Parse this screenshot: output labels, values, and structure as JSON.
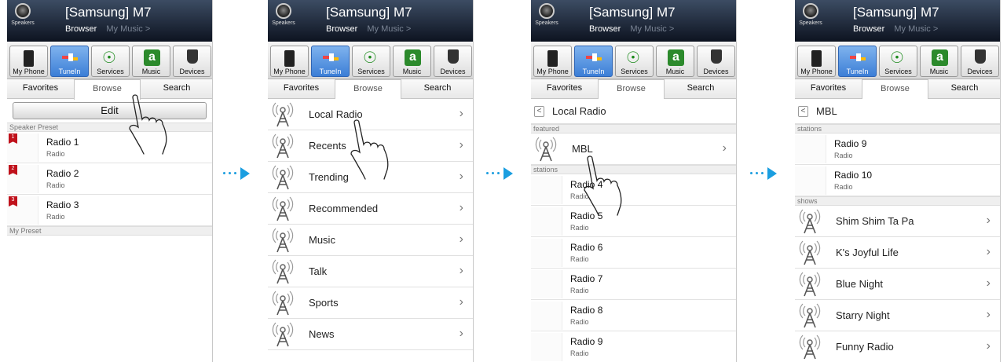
{
  "header": {
    "title": "[Samsung] M7",
    "speakers_label": "Speakers",
    "current_view": "Browser",
    "other_view": "My Music >"
  },
  "sources": [
    {
      "label": "My Phone",
      "icon": "phone-icon"
    },
    {
      "label": "TuneIn",
      "icon": "tunein-icon"
    },
    {
      "label": "Services",
      "icon": "globe-icon"
    },
    {
      "label": "Music",
      "icon": "amazon-icon"
    },
    {
      "label": "Devices",
      "icon": "devices-icon"
    }
  ],
  "tabs": [
    "Favorites",
    "Browse",
    "Search"
  ],
  "screen1": {
    "edit": "Edit",
    "speaker_preset": "Speaker Preset",
    "my_preset": "My Preset",
    "presets": [
      {
        "num": "1",
        "name": "Radio 1",
        "sub": "Radio"
      },
      {
        "num": "2",
        "name": "Radio 2",
        "sub": "Radio"
      },
      {
        "num": "3",
        "name": "Radio 3",
        "sub": "Radio"
      }
    ]
  },
  "screen2": {
    "items": [
      "Local Radio",
      "Recents",
      "Trending",
      "Recommended",
      "Music",
      "Talk",
      "Sports",
      "News"
    ]
  },
  "screen3": {
    "back": "Local Radio",
    "featured": "featured",
    "featured_item": "MBL",
    "stations_label": "stations",
    "stations": [
      {
        "name": "Radio 4",
        "sub": "Radio"
      },
      {
        "name": "Radio 5",
        "sub": "Radio"
      },
      {
        "name": "Radio 6",
        "sub": "Radio"
      },
      {
        "name": "Radio 7",
        "sub": "Radio"
      },
      {
        "name": "Radio 8",
        "sub": "Radio"
      },
      {
        "name": "Radio 9",
        "sub": "Radio"
      }
    ]
  },
  "screen4": {
    "back": "MBL",
    "stations_label": "stations",
    "shows_label": "shows",
    "stations": [
      {
        "name": "Radio 9",
        "sub": "Radio"
      },
      {
        "name": "Radio 10",
        "sub": "Radio"
      }
    ],
    "shows": [
      "Shim Shim Ta Pa",
      "K's Joyful Life",
      "Blue Night",
      "Starry Night",
      "Funny Radio"
    ]
  },
  "colors": {
    "accent": "#1b9ee0",
    "tunein_active": "#3c7ed6",
    "preset_flag": "#c0121c"
  }
}
